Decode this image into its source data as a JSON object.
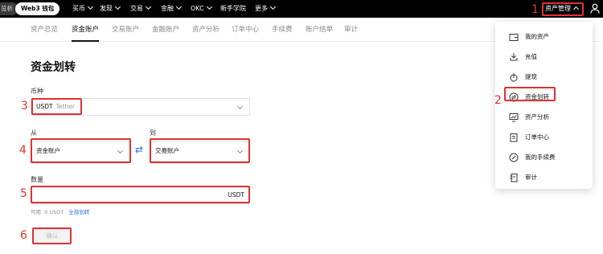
{
  "topnav": {
    "pill_prev": "览析",
    "pill_active": "Web3 钱包",
    "menu": [
      "买币",
      "发现",
      "交易",
      "金融",
      "OKC",
      "新手学院",
      "更多"
    ],
    "asset_mgmt": "资产管理"
  },
  "subnav": {
    "tabs": [
      "资产总览",
      "资金账户",
      "交易账户",
      "金融账户",
      "资产分析",
      "订单中心",
      "手续费",
      "账户结单",
      "审计"
    ],
    "active_index": 1
  },
  "page": {
    "title": "资金划转",
    "coin_label": "币种",
    "coin_symbol": "USDT",
    "coin_name": "Tether",
    "from_label": "从",
    "from_value": "资金账户",
    "to_label": "到",
    "to_value": "交易账户",
    "swap_symbol": "⇄",
    "amount_label": "数量",
    "amount_unit": "USDT",
    "available_label": "可用",
    "available_value": "0 USDT",
    "transfer_all": "全部划转",
    "confirm": "确认"
  },
  "dropdown": {
    "items": [
      "我的资产",
      "充值",
      "提现",
      "资金划转",
      "资产分析",
      "订单中心",
      "我的手续费",
      "审计"
    ],
    "highlight_index": 3
  },
  "annotations": [
    "1",
    "2",
    "3",
    "4",
    "5",
    "6"
  ],
  "colors": {
    "accent_red": "#e03131",
    "link_blue": "#2a6fdb",
    "topbar": "#000000"
  }
}
